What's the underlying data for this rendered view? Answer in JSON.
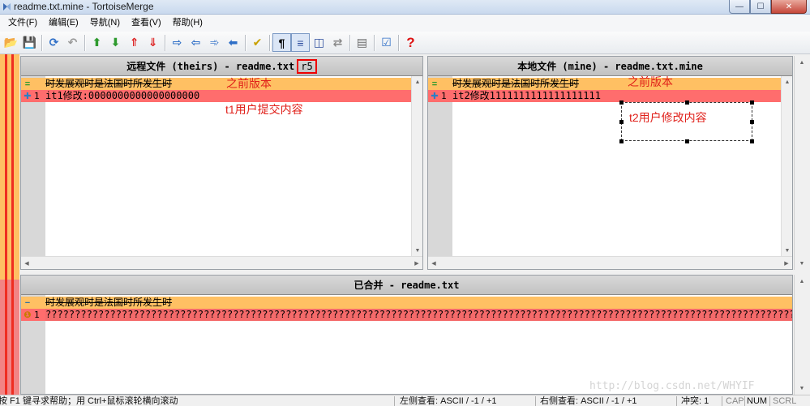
{
  "window": {
    "title": "readme.txt.mine - TortoiseMerge",
    "minimize": "—",
    "maximize": "☐",
    "close": "✕"
  },
  "menu": [
    "文件(F)",
    "编辑(E)",
    "导航(N)",
    "查看(V)",
    "帮助(H)"
  ],
  "toolbar": [
    {
      "name": "open-icon",
      "glyph": "📂"
    },
    {
      "name": "save-icon",
      "glyph": "💾"
    },
    {
      "name": "reload-icon",
      "glyph": "⟳"
    },
    {
      "name": "undo-icon",
      "glyph": "↶"
    },
    {
      "name": "prev-diff-icon",
      "glyph": "⬆"
    },
    {
      "name": "next-diff-icon",
      "glyph": "⬇"
    },
    {
      "name": "prev-conflict-icon",
      "glyph": "⇑"
    },
    {
      "name": "next-conflict-icon",
      "glyph": "⇓"
    },
    {
      "name": "use-theirs-icon",
      "glyph": "⇨"
    },
    {
      "name": "use-mine-icon",
      "glyph": "⇦"
    },
    {
      "name": "use-theirs-before-mine-icon",
      "glyph": "➾"
    },
    {
      "name": "use-mine-before-theirs-icon",
      "glyph": "⬅"
    },
    {
      "name": "mark-resolved-icon",
      "glyph": "✔"
    },
    {
      "name": "whitespace-icon",
      "glyph": "¶"
    },
    {
      "name": "inline-diff-icon",
      "glyph": "≡"
    },
    {
      "name": "one-pane-icon",
      "glyph": "◫"
    },
    {
      "name": "switch-panes-icon",
      "glyph": "⇄"
    },
    {
      "name": "create-patch-icon",
      "glyph": "▤"
    },
    {
      "name": "settings-icon",
      "glyph": "☑"
    },
    {
      "name": "help-icon",
      "glyph": "?"
    }
  ],
  "left_pane": {
    "header": "远程文件 (theirs) - readme.txt",
    "revision": "r5",
    "lines": [
      {
        "num": "",
        "text": "时发展观时是法国时所发生时",
        "state": "same"
      },
      {
        "num": "1",
        "text": "it1修改:0000000000000000000",
        "state": "diff"
      }
    ]
  },
  "right_pane": {
    "header": "本地文件 (mine) - readme.txt.mine",
    "lines": [
      {
        "num": "",
        "text": "时发展观时是法国时所发生时",
        "state": "same"
      },
      {
        "num": "1",
        "text": "it2修改1111111111111111111",
        "state": "diff"
      }
    ]
  },
  "merged_pane": {
    "header": "已合并 - readme.txt",
    "lines": [
      {
        "num": "",
        "text": "时发展观时是法国时所发生时",
        "state": "same"
      },
      {
        "num": "1",
        "text": "?????????????????????????????????????????????????????????????????????????????????????????????????????????????????????????????????????????????????",
        "state": "conflict"
      }
    ]
  },
  "annotations": {
    "left_previous": "之前版本",
    "left_commit": "t1用户提交内容",
    "right_previous": "之前版本",
    "right_modify": "t2用户修改内容"
  },
  "status": {
    "help": "按 F1 键寻求帮助；用 Ctrl+鼠标滚轮横向滚动",
    "left_view": "左侧查看: ASCII  / -1 / +1",
    "right_view": "右侧查看: ASCII  / -1 / +1",
    "conflicts": "冲突: 1",
    "cap": "CAP",
    "num": "NUM",
    "scrl": "SCRL"
  },
  "watermark": "http://blog.csdn.net/WHYIF"
}
